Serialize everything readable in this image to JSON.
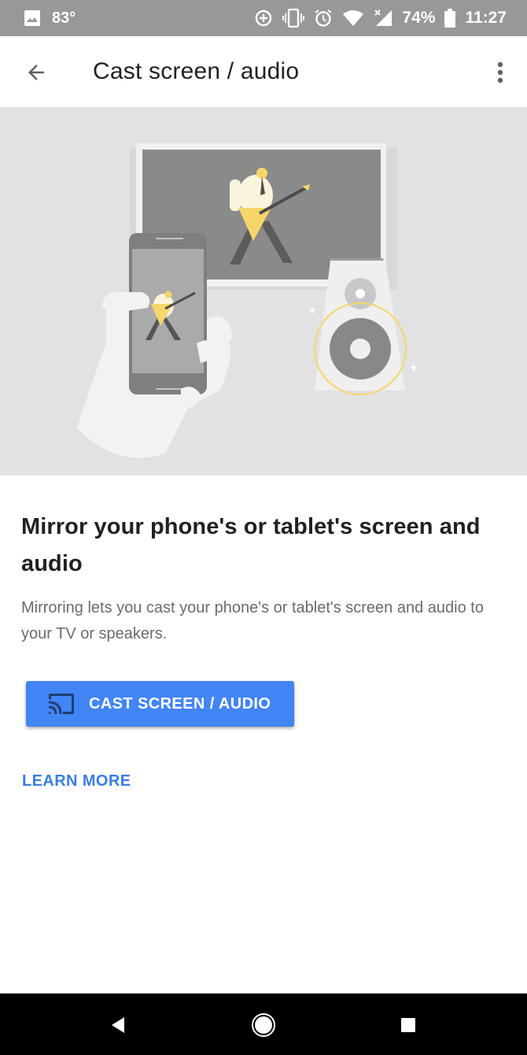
{
  "status_bar": {
    "notification_icon": "image-icon",
    "temperature": "83°",
    "icons": [
      "data-saver-icon",
      "vibrate-icon",
      "alarm-icon",
      "wifi-icon",
      "cell-signal-no-data-icon",
      "battery-icon"
    ],
    "battery_percent": "74%",
    "time": "11:27"
  },
  "app_bar": {
    "back_icon": "arrow-back-icon",
    "title": "Cast screen / audio",
    "overflow_icon": "more-vert-icon"
  },
  "hero": {
    "illustration": "hand holding phone mirroring guitarist to TV and speaker",
    "accent_color": "#f5d66a"
  },
  "content": {
    "heading": "Mirror your phone's or tablet's screen and audio",
    "description": "Mirroring lets you cast your phone's or tablet's screen and audio to your TV or speakers."
  },
  "actions": {
    "cast_button_label": "CAST SCREEN / AUDIO",
    "cast_button_icon": "cast-icon",
    "cast_button_color": "#4285f4",
    "learn_more_label": "LEARN MORE",
    "link_color": "#3b7de0"
  },
  "nav_bar": {
    "back": "nav-back-icon",
    "home": "nav-home-icon",
    "recents": "nav-recents-icon"
  }
}
